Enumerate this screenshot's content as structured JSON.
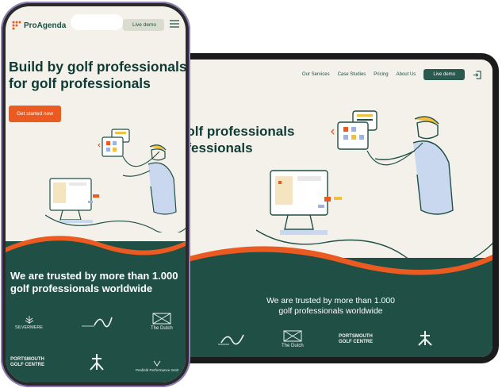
{
  "brand": {
    "name": "ProAgenda",
    "orange": "#ea5a21",
    "green": "#1f4f45",
    "cream": "#f4f1ea"
  },
  "tablet": {
    "nav": {
      "items": [
        "Our Services",
        "Case Studies",
        "Pricing",
        "About Us"
      ],
      "live_demo": "Live demo",
      "login_icon": "login-icon"
    },
    "hero": {
      "line1": "golf professionals",
      "line2": "ofessionals"
    },
    "trusted": {
      "line1": "We are trusted by more than 1.000",
      "line2": "golf professionals worldwide"
    },
    "logos": {
      "dutch": "The Dutch",
      "portsmouth_line1": "PORTSMOUTH",
      "portsmouth_line2": "GOLF CENTRE"
    }
  },
  "phone": {
    "header": {
      "logo": "ProAgenda",
      "live_demo": "Live demo",
      "menu_icon": "hamburger-menu-icon"
    },
    "hero": {
      "line1": "Build by golf professionals",
      "line2": "for golf professionals"
    },
    "cta": "Get started now",
    "trusted": {
      "line1": "We are trusted by more than 1.000",
      "line2": "golf professionals worldwide"
    },
    "logos": {
      "silvermere": "SILVERMERE",
      "dutch": "The Dutch",
      "portsmouth_line1": "PORTSMOUTH",
      "portsmouth_line2": "GOLF CENTRE",
      "performance": "Penfield Performance Instit"
    }
  }
}
